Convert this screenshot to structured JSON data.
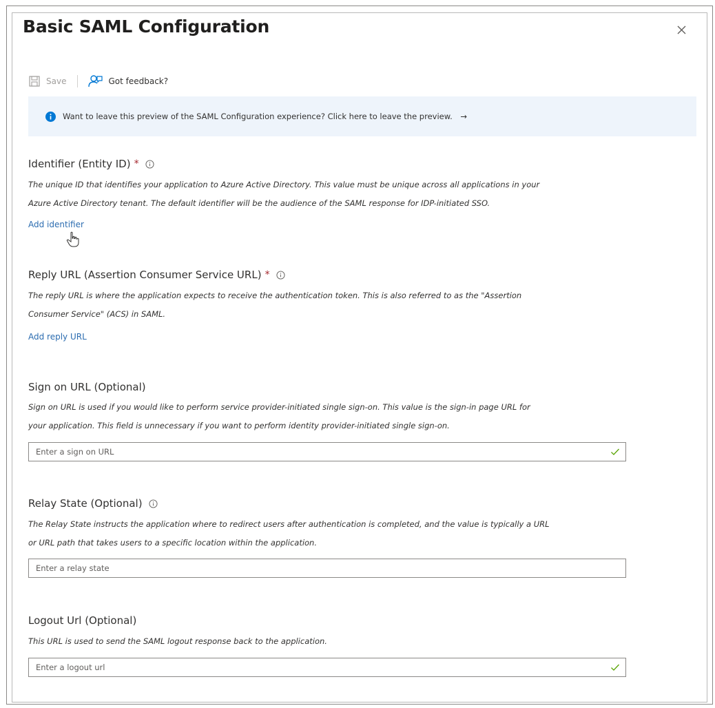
{
  "dialog": {
    "title": "Basic SAML Configuration"
  },
  "toolbar": {
    "save_label": "Save",
    "feedback_label": "Got feedback?"
  },
  "banner": {
    "text": "Want to leave this preview of the SAML Configuration experience? Click here to leave the preview.",
    "arrow": "→"
  },
  "identifier": {
    "label": "Identifier (Entity ID)",
    "required": "*",
    "description_line1": "The unique ID that identifies your application to Azure Active Directory. This value must be unique across all applications in your",
    "description_line2": "Azure Active Directory tenant. The default identifier will be the audience of the SAML response for IDP-initiated SSO.",
    "link": "Add identifier"
  },
  "reply_url": {
    "label": "Reply URL (Assertion Consumer Service URL)",
    "required": "*",
    "description_line1": "The reply URL is where the application expects to receive the authentication token. This is also referred to as the \"Assertion",
    "description_line2": "Consumer Service\" (ACS) in SAML.",
    "link": "Add reply URL"
  },
  "sign_on_url": {
    "label": "Sign on URL (Optional)",
    "description_line1": "Sign on URL is used if you would like to perform service provider-initiated single sign-on. This value is the sign-in page URL for",
    "description_line2": "your application. This field is unnecessary if you want to perform identity provider-initiated single sign-on.",
    "placeholder": "Enter a sign on URL",
    "value": ""
  },
  "relay_state": {
    "label": "Relay State (Optional)",
    "description_line1": "The Relay State instructs the application where to redirect users after authentication is completed, and the value is typically a URL",
    "description_line2": "or URL path that takes users to a specific location within the application.",
    "placeholder": "Enter a relay state",
    "value": ""
  },
  "logout_url": {
    "label": "Logout Url (Optional)",
    "description_line1": "This URL is used to send the SAML logout response back to the application.",
    "placeholder": "Enter a logout url",
    "value": ""
  },
  "icons": {
    "close": "close-icon",
    "save": "save-icon",
    "feedback": "feedback-icon",
    "info": "info-icon",
    "check": "checkmark-icon"
  },
  "colors": {
    "link": "#2b6cb0",
    "required": "#a4262c",
    "banner_bg": "#eef4fb",
    "info_blue": "#0078d4",
    "check_green": "#57a300"
  }
}
